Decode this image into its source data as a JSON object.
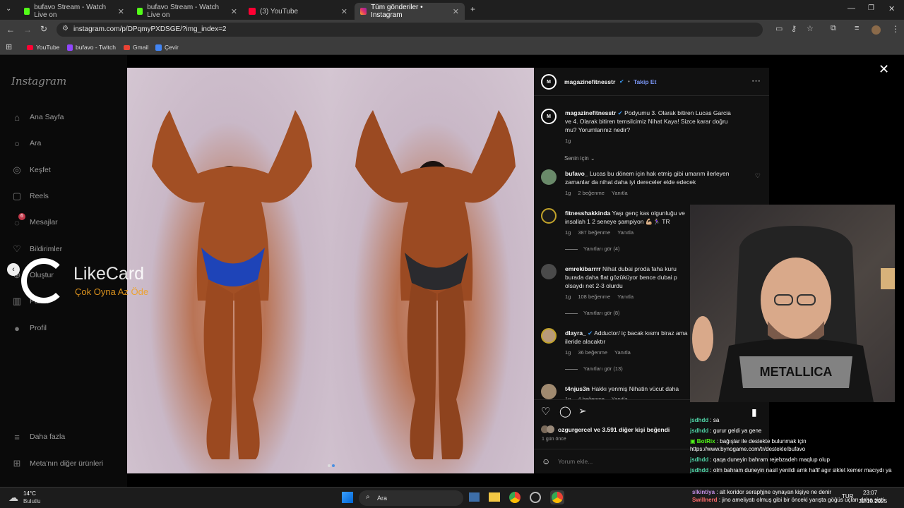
{
  "tabs": [
    {
      "title": "bufavo Stream - Watch Live on",
      "active": false,
      "color": "#53fc18"
    },
    {
      "title": "bufavo Stream - Watch Live on",
      "active": false,
      "color": "#53fc18"
    },
    {
      "title": "(3) YouTube",
      "active": false,
      "color": "#ff0033"
    },
    {
      "title": "Tüm gönderiler • Instagram",
      "active": true,
      "color": "#e1306c"
    }
  ],
  "url": "instagram.com/p/DPqmyPXDSGE/?img_index=2",
  "bookmarks": [
    "YouTube",
    "bufavo - Twitch",
    "Gmail",
    "Çevir"
  ],
  "sidebar": {
    "logo": "Instagram",
    "items": [
      "Ana Sayfa",
      "Ara",
      "Keşfet",
      "Reels",
      "Mesajlar",
      "Bildirimler",
      "Oluştur",
      "Panel",
      "Profil"
    ],
    "messages_badge": "6",
    "more": "Daha fazla",
    "meta": "Meta'nın diğer ürünleri"
  },
  "overlay": {
    "brand": "LikeCard",
    "tagline": "Çok Oyna Az Öde"
  },
  "post": {
    "author": "magazinefitnesstr",
    "follow": "Takip Et",
    "caption": "Podyumu 3. Olarak bitiren Lucas Garcia ve 4. Olarak bitiren temsilcimiz Nihat Kaya! Sizce karar doğru mu? Yorumlarınız nedir?",
    "caption_time": "1g",
    "sort": "Senin için",
    "comments": [
      {
        "user": "bufavo_",
        "text": "Lucas bu dönem için hak etmiş gibi umarım ilerleyen zamanlar da nihat daha iyi dereceler elde edecek",
        "time": "1g",
        "likes": "2 beğenme",
        "reply": "Yanıtla",
        "replies": ""
      },
      {
        "user": "fitnesshakkinda",
        "text": "Yaşı genç kas olgunluğu ve insallah 1 2 seneye şampiyon 💪🏼🏃🏻‍♀️ TR",
        "time": "1g",
        "likes": "387 beğenme",
        "reply": "Yanıtla",
        "replies": "Yanıtları gör (4)"
      },
      {
        "user": "emrekibarrrr",
        "text": "Nihat dubai proda faha kuru burada daha flat gözüküyor bence dubai p olsaydı net 2-3 olurdu",
        "time": "1g",
        "likes": "108 beğenme",
        "reply": "Yanıtla",
        "replies": "Yanıtları gör (8)"
      },
      {
        "user": "dlayra_",
        "text": "Adductor/ iç bacak kısmı biraz ama ileride alacaktır",
        "time": "1g",
        "likes": "36 beğenme",
        "reply": "Yanıtla",
        "replies": "Yanıtları gör (13)"
      },
      {
        "user": "t4njus3n",
        "text": "Hakkı yenmiş Nihatin vücut daha",
        "time": "1g",
        "likes": "4 beğenme",
        "reply": "Yanıtla",
        "replies": ""
      }
    ],
    "liked_by": "ozgurgercel",
    "liked_rest": "ve 3.591 diğer kişi beğendi",
    "ago": "1 gün önce",
    "comment_placeholder": "Yorum ekle..."
  },
  "chat": [
    {
      "user": "jsdhdd",
      "msg": "sa",
      "color": "#4fd1a5"
    },
    {
      "user": "jsdhdd",
      "msg": "gurur geldi ya gene",
      "color": "#4fd1a5"
    },
    {
      "user": "BotRix",
      "msg": "bağışlar ile destekte bulunmak için https://www.bynogame.com/tr/destekle/bufavo",
      "color": "#53fc18"
    },
    {
      "user": "jsdhdd",
      "msg": "qaqa duneyin bahram rejebzadeh maqlup olup",
      "color": "#4fd1a5"
    },
    {
      "user": "jsdhdd",
      "msg": "olm bahram duneyin nasil yenildi amk hafif agır siklet kemer macıydı ya",
      "color": "#4fd1a5"
    },
    {
      "user": "slkintiya",
      "msg": "alt koridor seraphine oynayan kişiye ne denir",
      "color": "#c792ea"
    },
    {
      "user": "Swillnerd",
      "msg": "jino ameliyatı olmuş gibi bir önceki yarışta göğüs uçları daha şişti",
      "color": "#ff6b6b"
    }
  ],
  "taskbar": {
    "temp": "14°C",
    "weather": "Bulutlu",
    "search": "Ara",
    "lang": "TUR",
    "time": "23:07",
    "date": "22.10.2025"
  }
}
